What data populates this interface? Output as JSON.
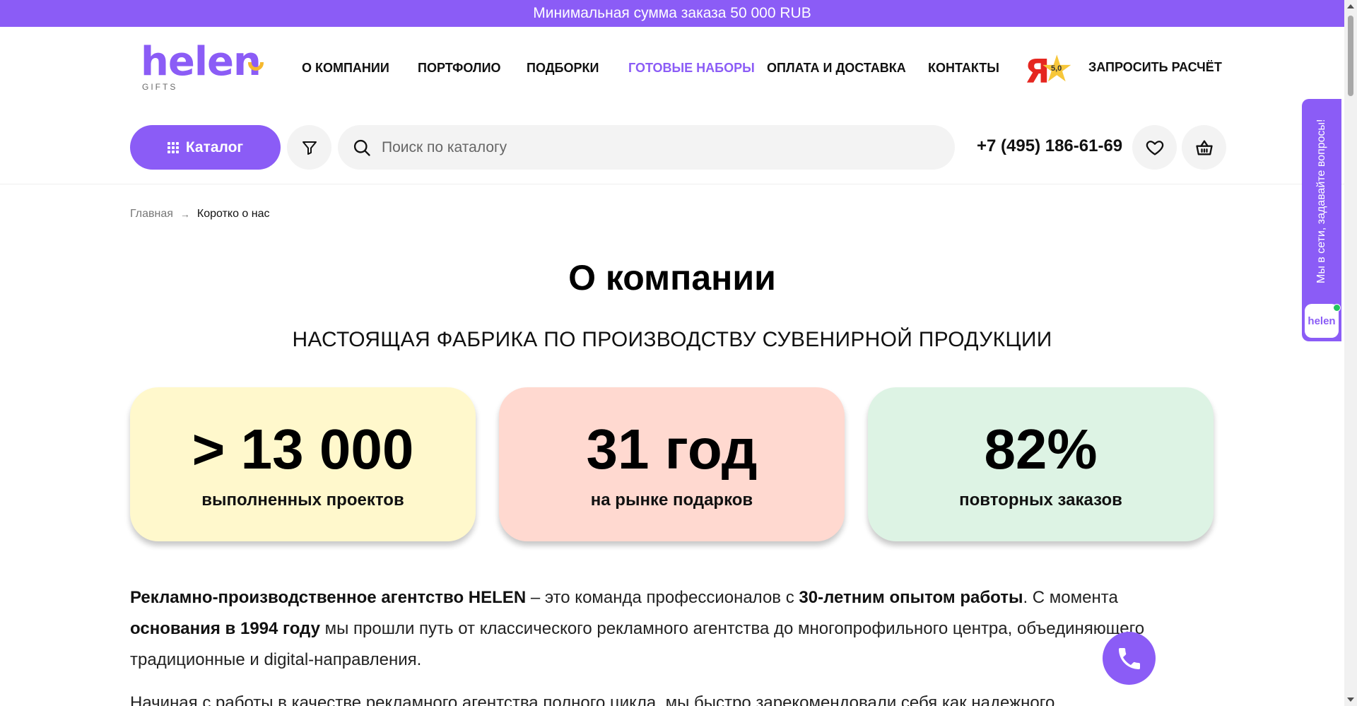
{
  "promo": {
    "text": "Минимальная сумма заказа 50 000 RUB"
  },
  "logo": {
    "word": "helen",
    "sub": "GIFTS"
  },
  "nav": {
    "items": [
      {
        "label": "О КОМПАНИИ"
      },
      {
        "label": "ПОРТФОЛИО"
      },
      {
        "label": "ПОДБОРКИ"
      },
      {
        "label": "ГОТОВЫЕ НАБОРЫ"
      },
      {
        "label": "ОПЛАТА И ДОСТАВКА"
      },
      {
        "label": "КОНТАКТЫ"
      }
    ],
    "active_index": 3
  },
  "yandex": {
    "letter": "Я",
    "score": "5,0"
  },
  "request_label": "ЗАПРОСИТЬ РАСЧЁТ",
  "catalog_label": "Каталог",
  "search": {
    "placeholder": "Поиск по каталогу"
  },
  "phone": "+7 (495) 186-61-69",
  "breadcrumb": {
    "home": "Главная",
    "current": "Коротко о нас"
  },
  "page": {
    "title": "О компании",
    "subtitle": "НАСТОЯЩАЯ ФАБРИКА ПО ПРОИЗВОДСТВУ СУВЕНИРНОЙ ПРОДУКЦИИ"
  },
  "stats": [
    {
      "value": "> 13 000",
      "label": "выполненных проектов",
      "color": "#fff8cc"
    },
    {
      "value": "31 год",
      "label": "на рынке подарков",
      "color": "#ffd9d0"
    },
    {
      "value": "82%",
      "label": "повторных заказов",
      "color": "#ddf3e4"
    }
  ],
  "text": {
    "p1_bold1": "Рекламно-производственное агентство HELEN",
    "p1_plain1": " – это команда профессионалов с ",
    "p1_bold2": "30-летним опытом работы",
    "p1_plain2": ". С момента ",
    "p1_bold3": "основания в 1994 году",
    "p1_plain3": " мы прошли путь от классического рекламного агентства до многопрофильного центра, объединяющего традиционные и digital-направления.",
    "p2": "Начиная с работы в качестве рекламного агентства полного цикла, мы быстро зарекомендовали себя как надежного"
  },
  "chat": {
    "text": "Мы в сети, задавайте вопросы!",
    "badge": "helen"
  },
  "colors": {
    "accent": "#8b5cf6"
  }
}
